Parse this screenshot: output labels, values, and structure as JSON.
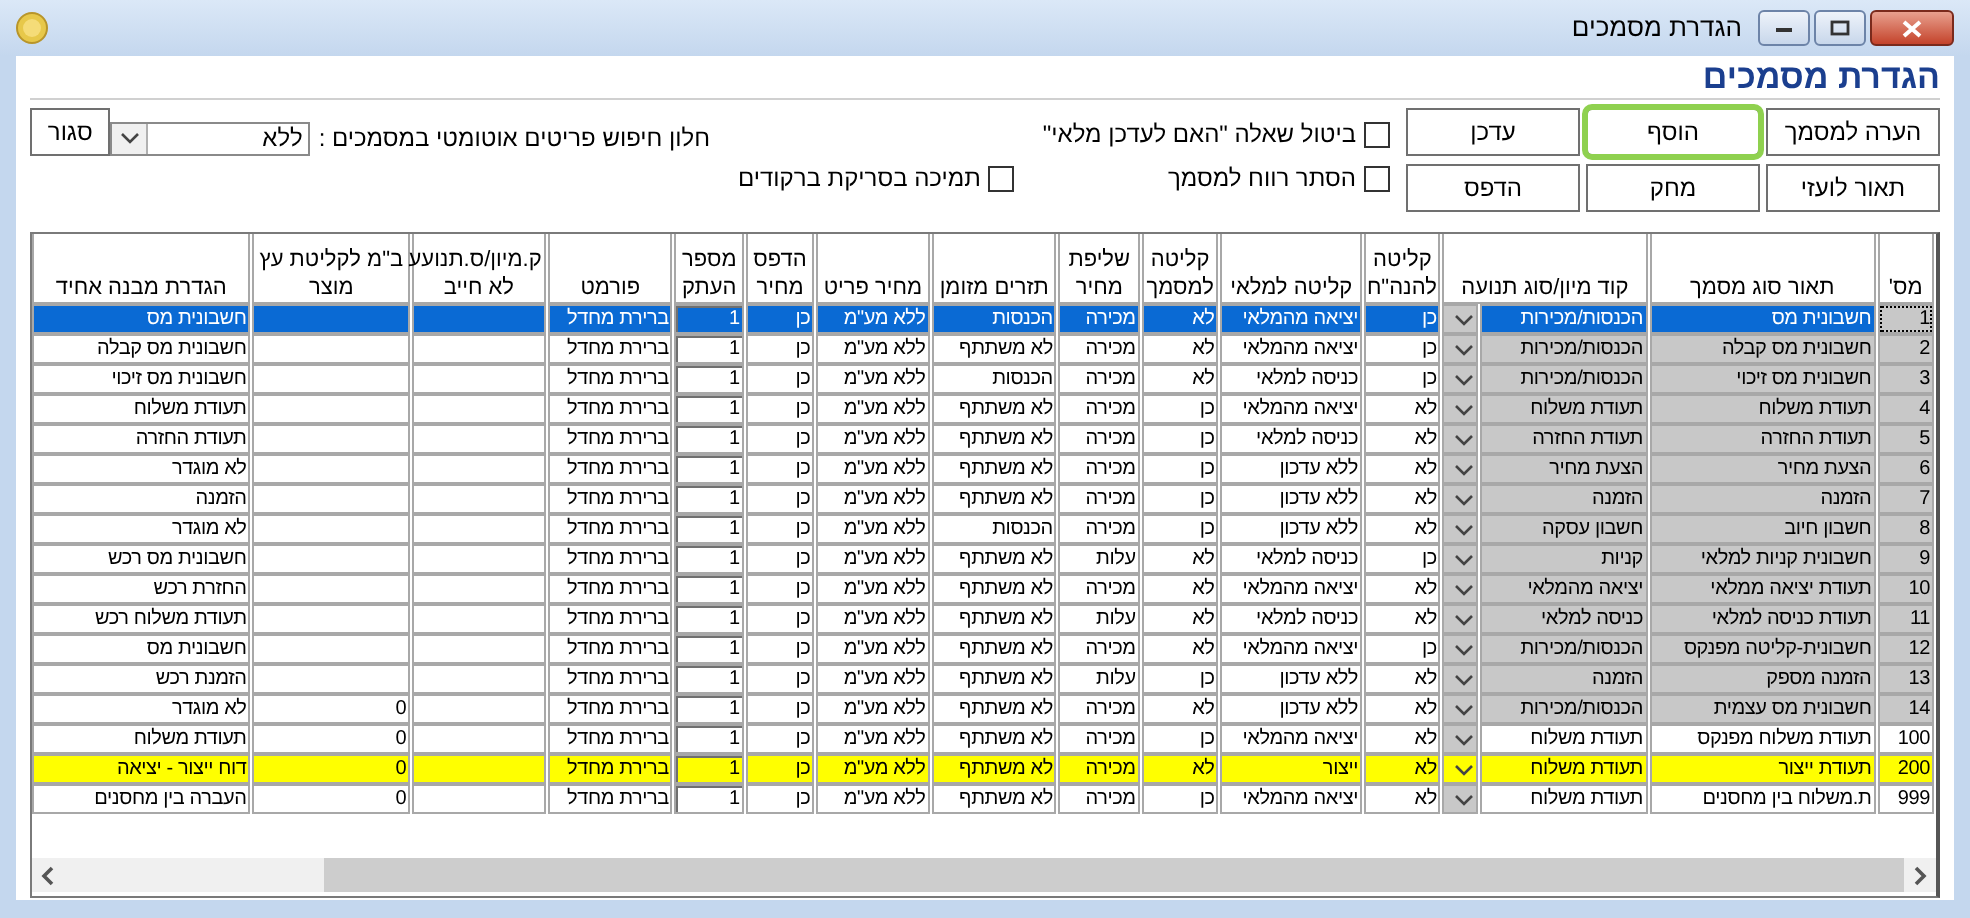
{
  "window": {
    "title": "הגדרת מסמכים"
  },
  "heading": "הגדרת מסמכים",
  "buttons": [
    {
      "label": "הערה למסמך",
      "focused": false
    },
    {
      "label": "הוסף",
      "focused": true
    },
    {
      "label": "עדכן",
      "focused": false
    },
    {
      "label": "תאור לועזי",
      "focused": false
    },
    {
      "label": "מחק",
      "focused": false
    },
    {
      "label": "הדפס",
      "focused": false
    }
  ],
  "options": [
    {
      "label": "ביטול שאלה \"האם לעדכן מלאי\"",
      "checked": false
    },
    {
      "label": "הסתר רווח למסמך",
      "checked": false
    },
    {
      "label": "תמיכה בסריקת ברקודים",
      "checked": false
    }
  ],
  "search_window": {
    "label": "חלון חיפוש פריטים אוטומטי במסמכים :",
    "value": "ללא"
  },
  "close_button": "סגור",
  "table": {
    "columns": [
      {
        "label": "מס'",
        "kind": "number"
      },
      {
        "label": "תאור סוג מסמך",
        "kind": "text"
      },
      {
        "label": "קוד מיון/סוג תנועה",
        "kind": "combo"
      },
      {
        "label": "קליטה להנה\"ח",
        "kind": "text"
      },
      {
        "label": "קליטה למלאי",
        "kind": "text"
      },
      {
        "label": "קליטה למסמך",
        "kind": "text"
      },
      {
        "label": "שליפת מחיר",
        "kind": "text"
      },
      {
        "label": "תזרים מזומן",
        "kind": "text"
      },
      {
        "label": "מחיר פריט",
        "kind": "text"
      },
      {
        "label": "הדפס מחיר",
        "kind": "text"
      },
      {
        "label": "מספר העתק",
        "kind": "spin"
      },
      {
        "label": "פורמט",
        "kind": "text"
      },
      {
        "label": "ק.מיון/ס.תנועע לא חייב",
        "kind": "text"
      },
      {
        "label": "ב\"מ לקליטת עץ מוצר",
        "kind": "text"
      },
      {
        "label": "הגדרת מבנה אחיד",
        "kind": "text"
      }
    ],
    "rows": [
      {
        "selected": true,
        "highlighted": false,
        "locked": true,
        "cells": [
          "1",
          "חשבונית מס",
          "הכנסות/מכירות",
          "כן",
          "יציאה מהמלאי",
          "לא",
          "מכירה",
          "הכנסות",
          "ללא מע\"מ",
          "כן",
          "1",
          "ברירת מחדל",
          null,
          null,
          "חשבונית מס"
        ]
      },
      {
        "selected": false,
        "highlighted": false,
        "locked": true,
        "cells": [
          "2",
          "חשבונית מס קבלה",
          "הכנסות/מכירות",
          "כן",
          "יציאה מהמלאי",
          "לא",
          "מכירה",
          "לא משתתף",
          "ללא מע\"מ",
          "כן",
          "1",
          "ברירת מחדל",
          null,
          null,
          "חשבונית מס קבלה"
        ]
      },
      {
        "selected": false,
        "highlighted": false,
        "locked": true,
        "cells": [
          "3",
          "חשבונית מס זיכוי",
          "הכנסות/מכירות",
          "כן",
          "כניסה למלאי",
          "לא",
          "מכירה",
          "הכנסות",
          "ללא מע\"מ",
          "כן",
          "1",
          "ברירת מחדל",
          null,
          null,
          "חשבונית מס זיכוי"
        ]
      },
      {
        "selected": false,
        "highlighted": false,
        "locked": true,
        "cells": [
          "4",
          "תעודת משלוח",
          "תעודת משלוח",
          "לא",
          "יציאה מהמלאי",
          "כן",
          "מכירה",
          "לא משתתף",
          "ללא מע\"מ",
          "כן",
          "1",
          "ברירת מחדל",
          null,
          null,
          "תעודת משלוח"
        ]
      },
      {
        "selected": false,
        "highlighted": false,
        "locked": true,
        "cells": [
          "5",
          "תעודת החזרה",
          "תעודת החזרה",
          "לא",
          "כניסה למלאי",
          "כן",
          "מכירה",
          "לא משתתף",
          "ללא מע\"מ",
          "כן",
          "1",
          "ברירת מחדל",
          null,
          null,
          "תעודת החזרה"
        ]
      },
      {
        "selected": false,
        "highlighted": false,
        "locked": true,
        "cells": [
          "6",
          "הצעת מחיר",
          "הצעת מחיר",
          "לא",
          "ללא עדכון",
          "כן",
          "מכירה",
          "לא משתתף",
          "ללא מע\"מ",
          "כן",
          "1",
          "ברירת מחדל",
          null,
          null,
          "לא מוגדר"
        ]
      },
      {
        "selected": false,
        "highlighted": false,
        "locked": true,
        "cells": [
          "7",
          "הזמנה",
          "הזמנה",
          "לא",
          "ללא עדכון",
          "כן",
          "מכירה",
          "לא משתתף",
          "ללא מע\"מ",
          "כן",
          "1",
          "ברירת מחדל",
          null,
          null,
          "הזמנה"
        ]
      },
      {
        "selected": false,
        "highlighted": false,
        "locked": true,
        "cells": [
          "8",
          "חשבון חיוב",
          "חשבון עסקה",
          "לא",
          "ללא עדכון",
          "כן",
          "מכירה",
          "הכנסות",
          "ללא מע\"מ",
          "כן",
          "1",
          "ברירת מחדל",
          null,
          null,
          "לא מוגדר"
        ]
      },
      {
        "selected": false,
        "highlighted": false,
        "locked": true,
        "cells": [
          "9",
          "חשבונית קניות למלאי",
          "קניות",
          "כן",
          "כניסה למלאי",
          "לא",
          "עלות",
          "לא משתתף",
          "ללא מע\"מ",
          "כן",
          "1",
          "ברירת מחדל",
          null,
          null,
          "חשבונית מס רכש"
        ]
      },
      {
        "selected": false,
        "highlighted": false,
        "locked": true,
        "cells": [
          "10",
          "תעודת יציאה ממלאי",
          "יציאה מהמלאי",
          "לא",
          "יציאה מהמלאי",
          "לא",
          "מכירה",
          "לא משתתף",
          "ללא מע\"מ",
          "כן",
          "1",
          "ברירת מחדל",
          null,
          null,
          "החזרת רכש"
        ]
      },
      {
        "selected": false,
        "highlighted": false,
        "locked": true,
        "cells": [
          "11",
          "תעודת כניסה למלאי",
          "כניסה למלאי",
          "לא",
          "כניסה למלאי",
          "לא",
          "עלות",
          "לא משתתף",
          "ללא מע\"מ",
          "כן",
          "1",
          "ברירת מחדל",
          null,
          null,
          "תעודת משלוח רכש"
        ]
      },
      {
        "selected": false,
        "highlighted": false,
        "locked": true,
        "cells": [
          "12",
          "חשבונית-קליטה מפנקס",
          "הכנסות/מכירות",
          "כן",
          "יציאה מהמלאי",
          "לא",
          "מכירה",
          "לא משתתף",
          "ללא מע\"מ",
          "כן",
          "1",
          "ברירת מחדל",
          null,
          null,
          "חשבונית מס"
        ]
      },
      {
        "selected": false,
        "highlighted": false,
        "locked": true,
        "cells": [
          "13",
          "הזמנה מספק",
          "הזמנה",
          "לא",
          "ללא עדכון",
          "כן",
          "עלות",
          "לא משתתף",
          "ללא מע\"מ",
          "כן",
          "1",
          "ברירת מחדל",
          null,
          null,
          "הזמנת רכש"
        ]
      },
      {
        "selected": false,
        "highlighted": false,
        "locked": true,
        "cells": [
          "14",
          "חשבונית מס עצמית",
          "הכנסות/מכירות",
          "לא",
          "ללא עדכון",
          "לא",
          "מכירה",
          "לא משתתף",
          "ללא מע\"מ",
          "כן",
          "1",
          "ברירת מחדל",
          null,
          "0",
          "לא מוגדר"
        ]
      },
      {
        "selected": false,
        "highlighted": false,
        "locked": false,
        "cells": [
          "100",
          "תעודת משלוח מפנקס",
          "תעודת משלוח",
          "לא",
          "יציאה מהמלאי",
          "כן",
          "מכירה",
          "לא משתתף",
          "ללא מע\"מ",
          "כן",
          "1",
          "ברירת מחדל",
          null,
          "0",
          "תעודת משלוח"
        ]
      },
      {
        "selected": false,
        "highlighted": true,
        "locked": false,
        "cells": [
          "200",
          "תעודת ייצור",
          "תעודת משלוח",
          "לא",
          "ייצור",
          "לא",
          "מכירה",
          "לא משתתף",
          "ללא מע\"מ",
          "כן",
          "1",
          "ברירת מחדל",
          null,
          "0",
          "דוח ייצור - יציאה"
        ]
      },
      {
        "selected": false,
        "highlighted": false,
        "locked": false,
        "cells": [
          "999",
          "ת.משלוח בין מחסנים",
          "תעודת משלוח",
          "לא",
          "יציאה מהמלאי",
          "כן",
          "מכירה",
          "לא משתתף",
          "ללא מע\"מ",
          "כן",
          "1",
          "ברירת מחדל",
          null,
          "0",
          "העברה בין מחסנים"
        ]
      }
    ]
  }
}
